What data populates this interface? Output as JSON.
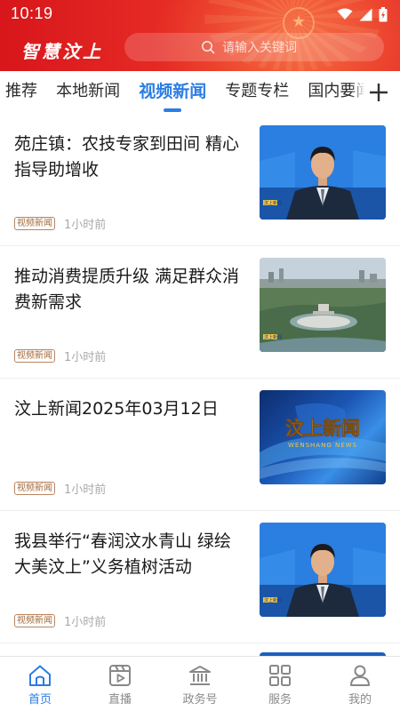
{
  "status_bar": {
    "time": "10:19"
  },
  "header": {
    "app_name": "智慧汶上",
    "search_placeholder": "请输入关键词"
  },
  "tabs": [
    {
      "label": "推荐"
    },
    {
      "label": "本地新闻"
    },
    {
      "label": "视频新闻",
      "active": true
    },
    {
      "label": "专题专栏"
    },
    {
      "label": "国内要闻"
    }
  ],
  "news": [
    {
      "title": "苑庄镇：农技专家到田间  精心指导助增收",
      "tag": "视频新闻",
      "time": "1小时前",
      "thumb": "anchor"
    },
    {
      "title": "推动消费提质升级  满足群众消费新需求",
      "tag": "视频新闻",
      "time": "1小时前",
      "thumb": "city"
    },
    {
      "title": "汶上新闻2025年03月12日",
      "tag": "视频新闻",
      "time": "1小时前",
      "thumb": "logo",
      "thumb_text": "汶上新闻",
      "thumb_subtext": "WENSHANG NEWS"
    },
    {
      "title": "我县举行“春润汶水青山  绿绘大美汶上”义务植树活动",
      "tag": "视频新闻",
      "time": "1小时前",
      "thumb": "anchor"
    }
  ],
  "thumb_badge": "汶上新闻",
  "bottom_nav": [
    {
      "label": "首页",
      "icon": "home-icon",
      "active": true
    },
    {
      "label": "直播",
      "icon": "live-video-icon"
    },
    {
      "label": "政务号",
      "icon": "government-building-icon"
    },
    {
      "label": "服务",
      "icon": "grid-services-icon"
    },
    {
      "label": "我的",
      "icon": "user-icon"
    }
  ],
  "colors": {
    "header_red": "#e52a24",
    "accent_blue": "#2b7de3",
    "tag_brown": "#a46a3a"
  }
}
